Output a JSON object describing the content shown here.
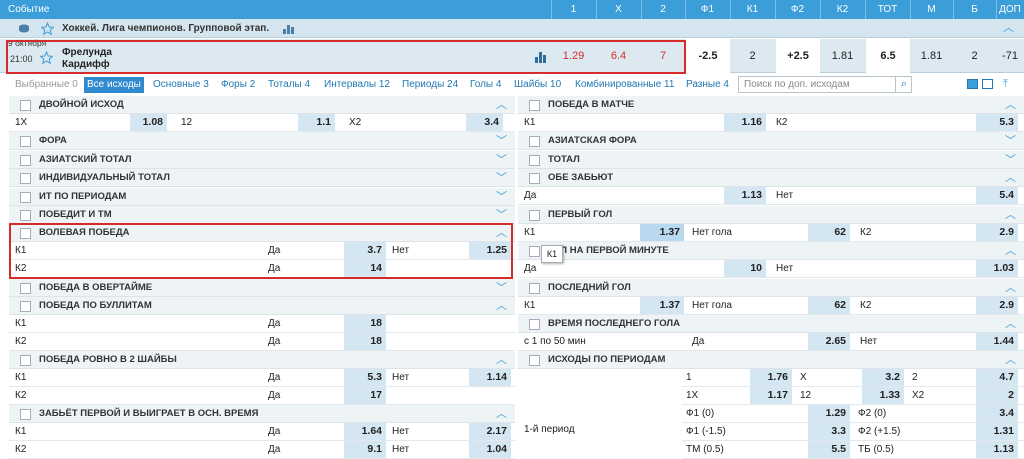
{
  "header": {
    "event": "Событие",
    "cols": [
      "1",
      "X",
      "2",
      "Ф1",
      "К1",
      "Ф2",
      "К2",
      "ТОТ",
      "М",
      "Б",
      "ДОП"
    ]
  },
  "league": {
    "title": "Хоккей. Лига чемпионов. Групповой этап."
  },
  "match": {
    "date": "9 октября",
    "time": "21:00",
    "team1": "Фрелунда",
    "team2": "Кардифф",
    "odds": [
      "1.29",
      "6.4",
      "7",
      "-2.5",
      "2",
      "+2.5",
      "1.81",
      "6.5",
      "1.81",
      "2",
      "-71"
    ]
  },
  "tabs": [
    "Выбранные 0",
    "Все исходы",
    "Основные 3",
    "Форы 2",
    "Тоталы 4",
    "Интервалы 12",
    "Периоды 24",
    "Голы 4",
    "Шайбы 10",
    "Комбинированные 11",
    "Разные 4"
  ],
  "search": {
    "placeholder": "Поиск по доп. исходам"
  },
  "tooltip": "К1",
  "left": {
    "s1": "ДВОЙНОЙ ИСХОД",
    "r1": [
      "1Х",
      "1.08",
      "12",
      "1.1",
      "Х2",
      "3.4"
    ],
    "s2": "ФОРА",
    "s3": "АЗИАТСКИЙ ТОТАЛ",
    "s4": "ИНДИВИДУАЛЬНЫЙ ТОТАЛ",
    "s5": "ИТ ПО ПЕРИОДАМ",
    "s6": "ПОБЕДИТ И ТМ",
    "s7": "ВОЛЕВАЯ ПОБЕДА",
    "r7a": [
      "К1",
      "Да",
      "3.7",
      "Нет",
      "1.25"
    ],
    "r7b": [
      "К2",
      "Да",
      "14"
    ],
    "s8": "ПОБЕДА В ОВЕРТАЙМЕ",
    "s9": "ПОБЕДА ПО БУЛЛИТАМ",
    "r9a": [
      "К1",
      "Да",
      "18"
    ],
    "r9b": [
      "К2",
      "Да",
      "18"
    ],
    "s10": "ПОБЕДА РОВНО В 2 ШАЙБЫ",
    "r10a": [
      "К1",
      "Да",
      "5.3",
      "Нет",
      "1.14"
    ],
    "r10b": [
      "К2",
      "Да",
      "17"
    ],
    "s11": "ЗАБЬЁТ ПЕРВОЙ И ВЫИГРАЕТ В ОСН. ВРЕМЯ",
    "r11a": [
      "К1",
      "Да",
      "1.64",
      "Нет",
      "2.17"
    ],
    "r11b": [
      "К2",
      "Да",
      "9.1",
      "Нет",
      "1.04"
    ]
  },
  "right": {
    "s1": "ПОБЕДА В МАТЧЕ",
    "r1": [
      "К1",
      "1.16",
      "К2",
      "5.3"
    ],
    "s2": "АЗИАТСКАЯ ФОРА",
    "s3": "ТОТАЛ",
    "s4": "ОБЕ ЗАБЬЮТ",
    "r4": [
      "Да",
      "1.13",
      "Нет",
      "5.4"
    ],
    "s5": "ПЕРВЫЙ ГОЛ",
    "r5": [
      "К1",
      "1.37",
      "Нет гола",
      "62",
      "К2",
      "2.9"
    ],
    "s6": "ГОЛ НА ПЕРВОЙ МИНУТЕ",
    "r6": [
      "Да",
      "10",
      "Нет",
      "1.03"
    ],
    "s7": "ПОСЛЕДНИЙ ГОЛ",
    "r7": [
      "К1",
      "1.37",
      "Нет гола",
      "62",
      "К2",
      "2.9"
    ],
    "s8": "ВРЕМЯ ПОСЛЕДНЕГО ГОЛА",
    "r8": [
      "с 1 по 50 мин",
      "Да",
      "2.65",
      "Нет",
      "1.44"
    ],
    "s9": "ИСХОДЫ ПО ПЕРИОДАМ",
    "period": "1-й период",
    "p1": [
      "1",
      "1.76",
      "Х",
      "3.2",
      "2",
      "4.7"
    ],
    "p2": [
      "1Х",
      "1.17",
      "12",
      "1.33",
      "Х2",
      "2"
    ],
    "p3": [
      "Ф1 (0)",
      "1.29",
      "Ф2 (0)",
      "3.4"
    ],
    "p4": [
      "Ф1 (-1.5)",
      "3.3",
      "Ф2 (+1.5)",
      "1.31"
    ],
    "p5": [
      "ТМ (0.5)",
      "5.5",
      "ТБ (0.5)",
      "1.13"
    ]
  },
  "colors": {
    "header": "#3c9ed8",
    "accent": "#d62b2b",
    "odds_bg": "#d4e6f1"
  }
}
